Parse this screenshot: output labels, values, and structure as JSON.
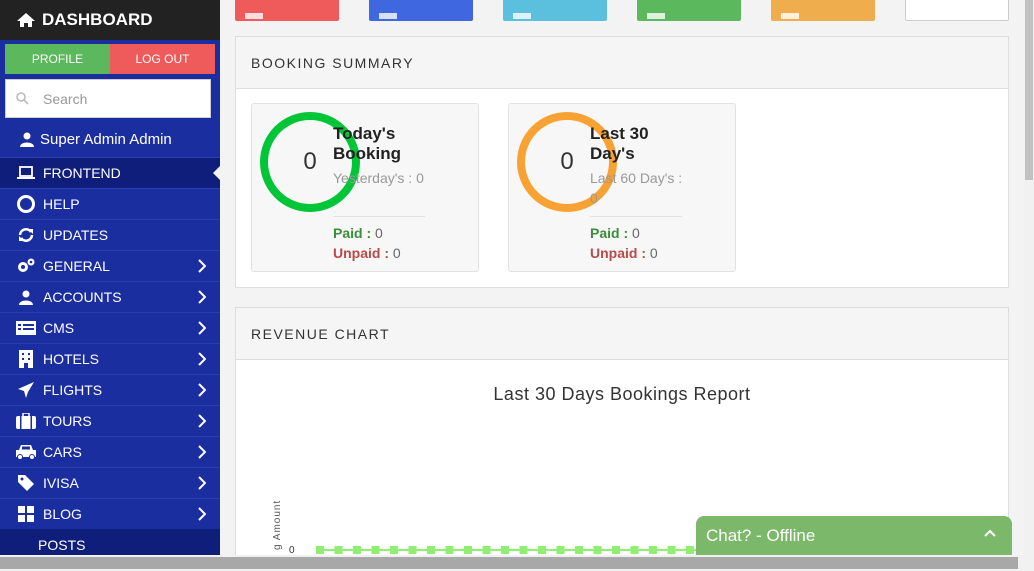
{
  "sidebar": {
    "brand": "DASHBOARD",
    "profile_label": "PROFILE",
    "logout_label": "LOG OUT",
    "search_placeholder": "Search",
    "user_name": "Super Admin Admin",
    "items": [
      {
        "label": "FRONTEND",
        "icon": "laptop-icon",
        "active": true
      },
      {
        "label": "HELP",
        "icon": "life-ring-icon"
      },
      {
        "label": "UPDATES",
        "icon": "refresh-icon"
      },
      {
        "label": "GENERAL",
        "icon": "gears-icon",
        "chevron": true
      },
      {
        "label": "ACCOUNTS",
        "icon": "user-icon",
        "chevron": true
      },
      {
        "label": "CMS",
        "icon": "list-icon",
        "chevron": true
      },
      {
        "label": "HOTELS",
        "icon": "building-icon",
        "chevron": true
      },
      {
        "label": "FLIGHTS",
        "icon": "plane-icon",
        "chevron": true
      },
      {
        "label": "TOURS",
        "icon": "suitcase-icon",
        "chevron": true
      },
      {
        "label": "CARS",
        "icon": "car-icon",
        "chevron": true
      },
      {
        "label": "IVISA",
        "icon": "tag-icon",
        "chevron": true
      },
      {
        "label": "BLOG",
        "icon": "grid-icon",
        "chevron": true
      }
    ],
    "sub_item": "POSTS"
  },
  "booking_summary": {
    "heading": "BOOKING SUMMARY",
    "cards": [
      {
        "count": "0",
        "title": "Today's Booking",
        "sub": "Yesterday's : 0",
        "paid_label": "Paid :",
        "paid": "0",
        "unpaid_label": "Unpaid :",
        "unpaid": "0",
        "color": "#00c637"
      },
      {
        "count": "0",
        "title": "Last 30 Day's",
        "sub": "Last 60 Day's : 0",
        "paid_label": "Paid :",
        "paid": "0",
        "unpaid_label": "Unpaid :",
        "unpaid": "0",
        "color": "#f7a233"
      }
    ]
  },
  "revenue": {
    "heading": "REVENUE CHART",
    "chart_title": "Last 30 Days Bookings Report",
    "y_axis_label": "g Amount",
    "y_tick": "0"
  },
  "chart_data": {
    "type": "line",
    "title": "Last 30 Days Bookings Report",
    "ylabel": "Amount",
    "series": [
      {
        "values": [
          0,
          0,
          0,
          0,
          0,
          0,
          0,
          0,
          0,
          0,
          0,
          0,
          0,
          0,
          0,
          0,
          0,
          0,
          0,
          0,
          0,
          0,
          0,
          0,
          0
        ]
      }
    ],
    "color": "#90ee70"
  },
  "chat": {
    "label": "Chat? - Offline"
  }
}
